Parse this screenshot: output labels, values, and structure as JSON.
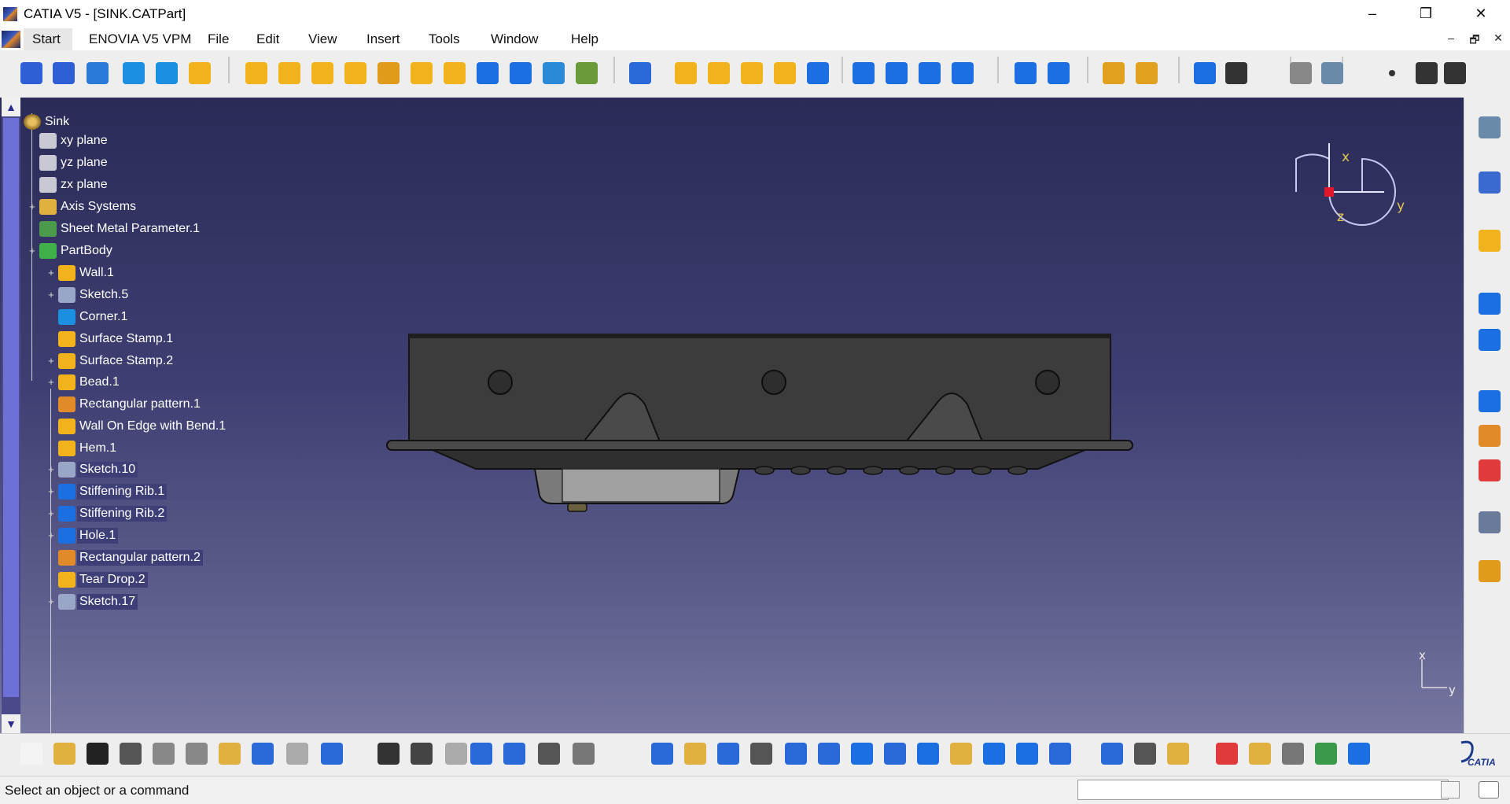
{
  "window": {
    "title": "CATIA V5 - [SINK.CATPart]",
    "minimize": "–",
    "restore": "❐",
    "close": "✕"
  },
  "menu": {
    "items": [
      "Start",
      "ENOVIA V5 VPM",
      "File",
      "Edit",
      "View",
      "Insert",
      "Tools",
      "Window",
      "Help"
    ],
    "mdi": [
      "–",
      "🗗",
      "✕"
    ]
  },
  "tree": {
    "root": "Sink",
    "nodes": [
      {
        "label": "xy plane",
        "icon": "plane-icon",
        "color": "#c9c9d4"
      },
      {
        "label": "yz plane",
        "icon": "plane-icon",
        "color": "#c9c9d4"
      },
      {
        "label": "zx plane",
        "icon": "plane-icon",
        "color": "#c9c9d4"
      },
      {
        "label": "Axis Systems",
        "icon": "axis-system-icon",
        "color": "#e0b040"
      },
      {
        "label": "Sheet Metal Parameter.1",
        "icon": "sheet-metal-parameter-icon",
        "color": "#4c9a4c"
      },
      {
        "label": "PartBody",
        "icon": "partbody-gear-icon",
        "color": "#3fb04a"
      },
      {
        "label": "Wall.1",
        "icon": "wall-icon",
        "color": "#f2b21c"
      },
      {
        "label": "Sketch.5",
        "icon": "sketch-icon",
        "color": "#9aa6c8"
      },
      {
        "label": "Corner.1",
        "icon": "corner-icon",
        "color": "#1c8fe0"
      },
      {
        "label": "Surface Stamp.1",
        "icon": "surface-stamp-icon",
        "color": "#f2b21c"
      },
      {
        "label": "Surface Stamp.2",
        "icon": "surface-stamp-icon",
        "color": "#f2b21c"
      },
      {
        "label": "Bead.1",
        "icon": "bead-icon",
        "color": "#f2b21c"
      },
      {
        "label": "Rectangular pattern.1",
        "icon": "rectangular-pattern-icon",
        "color": "#e08a2a"
      },
      {
        "label": "Wall On Edge with Bend.1",
        "icon": "wall-on-edge-icon",
        "color": "#f2b21c"
      },
      {
        "label": "Hem.1",
        "icon": "hem-icon",
        "color": "#f2b21c"
      },
      {
        "label": "Sketch.10",
        "icon": "sketch-icon",
        "color": "#9aa6c8"
      },
      {
        "label": "Stiffening Rib.1",
        "icon": "stiffening-rib-icon",
        "color": "#1c6fe0"
      },
      {
        "label": "Stiffening Rib.2",
        "icon": "stiffening-rib-icon",
        "color": "#1c6fe0"
      },
      {
        "label": "Hole.1",
        "icon": "hole-icon",
        "color": "#1c6fe0"
      },
      {
        "label": "Rectangular pattern.2",
        "icon": "rectangular-pattern-icon",
        "color": "#e08a2a"
      },
      {
        "label": "Tear Drop.2",
        "icon": "tear-drop-icon",
        "color": "#f2b21c"
      },
      {
        "label": "Sketch.17",
        "icon": "sketch-icon",
        "color": "#9aa6c8"
      }
    ]
  },
  "compass": {
    "x": "x",
    "y": "y",
    "z": "z"
  },
  "axis_indicator": {
    "x": "x",
    "y": "y"
  },
  "status": {
    "message": "Select an object or a command"
  },
  "brand": {
    "logo": "CATIA"
  },
  "colors": {
    "accent": "#1c6fe0",
    "highlight": "#f2b21c",
    "viewport_top": "#2b2b58",
    "viewport_bottom": "#7676a0"
  }
}
